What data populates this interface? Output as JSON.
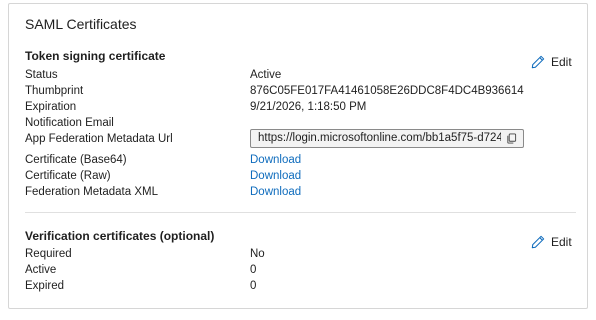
{
  "card": {
    "title": "SAML Certificates"
  },
  "token_section": {
    "title": "Token signing certificate",
    "edit_label": "Edit",
    "rows": [
      {
        "label": "Status",
        "value": "Active"
      },
      {
        "label": "Thumbprint",
        "value": "876C05FE017FA41461058E26DDC8F4DC4B936614"
      },
      {
        "label": "Expiration",
        "value": "9/21/2026, 1:18:50 PM"
      },
      {
        "label": "Notification Email",
        "value": ""
      },
      {
        "label": "App Federation Metadata Url",
        "value": "https://login.microsoftonline.com/bb1a5f75-d724..."
      },
      {
        "label": "Certificate (Base64)",
        "value": "Download"
      },
      {
        "label": "Certificate (Raw)",
        "value": "Download"
      },
      {
        "label": "Federation Metadata XML",
        "value": "Download"
      }
    ]
  },
  "verification_section": {
    "title": "Verification certificates (optional)",
    "edit_label": "Edit",
    "rows": [
      {
        "label": "Required",
        "value": "No"
      },
      {
        "label": "Active",
        "value": "0"
      },
      {
        "label": "Expired",
        "value": "0"
      }
    ]
  },
  "icons": {
    "edit": "pencil-icon",
    "copy": "copy-icon"
  },
  "colors": {
    "link": "#0f6cbd",
    "icon_blue": "#0f6cbd"
  }
}
